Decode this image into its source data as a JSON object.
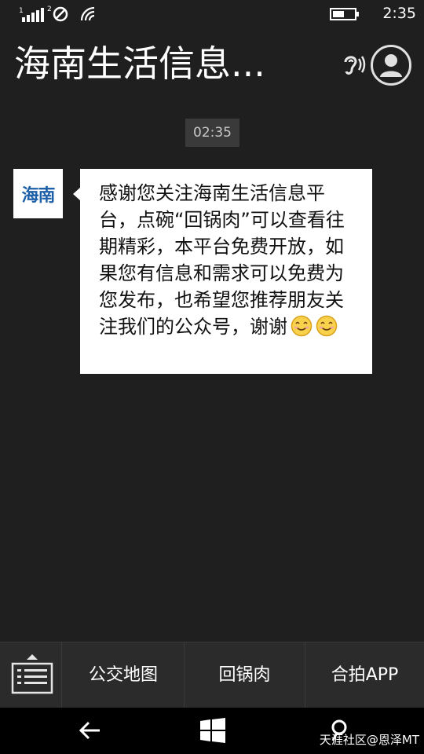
{
  "status_bar": {
    "sim1_label": "1",
    "sim2_label": "2",
    "time": "2:35"
  },
  "header": {
    "title": "海南生活信息...",
    "ear_icon": "ear-icon",
    "profile_icon": "person-icon"
  },
  "chat": {
    "timestamp": "02:35",
    "sender_avatar_text": "海南",
    "message_text": "感谢您关注海南生活信息平台，点碗“回锅肉”可以查看往期精彩，本平台免费开放，如果您有信息和需求可以免费为您发布，也希望您推荐朋友关注我们的公众号，谢谢",
    "emoji_count": 2
  },
  "menu": {
    "toggle_icon": "keyboard-icon",
    "items": [
      {
        "label": "公交地图"
      },
      {
        "label": "回锅肉"
      },
      {
        "label": "合拍APP"
      }
    ]
  },
  "nav": {
    "back_icon": "back-arrow-icon",
    "start_icon": "windows-icon",
    "search_icon": "search-icon"
  },
  "watermark": "天涯社区@恩泽MT",
  "colors": {
    "background": "#1f1f1f",
    "bubble": "#ffffff",
    "menu_bar": "#2b2b2b",
    "nav_bar": "#000000",
    "avatar_brand": "#1d5fa8"
  }
}
